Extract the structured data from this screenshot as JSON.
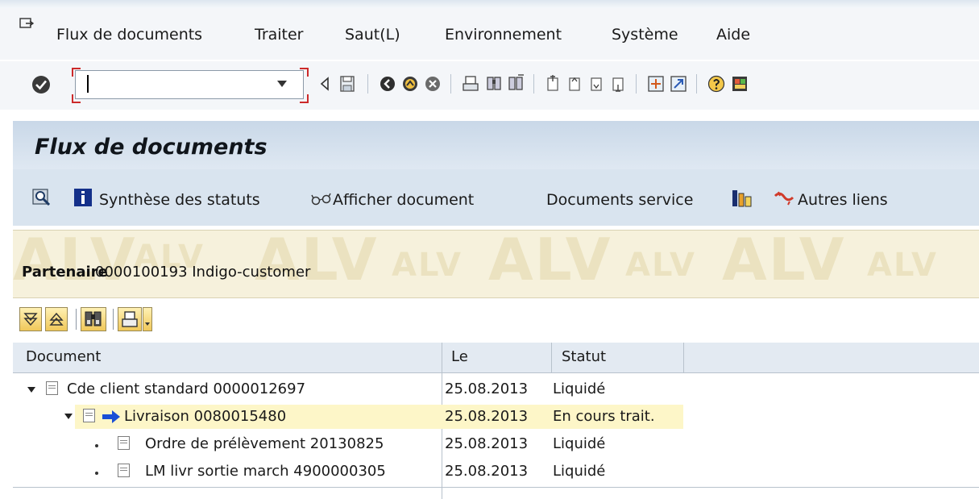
{
  "menu": {
    "items": [
      {
        "label": "Flux de documents"
      },
      {
        "label": "Traiter"
      },
      {
        "label": "Saut(L)"
      },
      {
        "label": "Environnement"
      },
      {
        "label": "Système"
      },
      {
        "label": "Aide"
      }
    ]
  },
  "toolbar": {
    "command_value": "",
    "icons": [
      "enter-icon",
      "back-icon",
      "save-icon",
      "green-back-icon",
      "exit-icon",
      "cancel-icon",
      "print-icon",
      "find-icon",
      "find-next-icon",
      "first-page-icon",
      "previous-page-icon",
      "next-page-icon",
      "last-page-icon",
      "create-session-icon",
      "shortcut-icon",
      "help-icon",
      "layout-icon"
    ]
  },
  "title": "Flux de documents",
  "app_toolbar": {
    "status_overview": "Synthèse des statuts",
    "display_document": "Afficher document",
    "service_documents": "Documents service",
    "other_links": "Autres liens"
  },
  "header": {
    "partner_label": "Partenaire",
    "partner_value": "0000100193 Indigo-customer",
    "watermark": "ALV"
  },
  "table": {
    "columns": [
      "Document",
      "Le",
      "Statut"
    ],
    "rows": [
      {
        "document": "Cde client standard 0000012697",
        "date": "25.08.2013",
        "status": "Liquidé"
      },
      {
        "document": "Livraison 0080015480",
        "date": "25.08.2013",
        "status": "En cours trait."
      },
      {
        "document": "Ordre de prélèvement 20130825",
        "date": "25.08.2013",
        "status": "Liquidé"
      },
      {
        "document": "LM livr sortie march 4900000305",
        "date": "25.08.2013",
        "status": "Liquidé"
      }
    ]
  },
  "colors": {
    "highlight_row": "#fdf6c8",
    "title_bar": "#c9d8e8",
    "alv_band": "#f6f1dc",
    "current_arrow": "#1a4fd6"
  }
}
